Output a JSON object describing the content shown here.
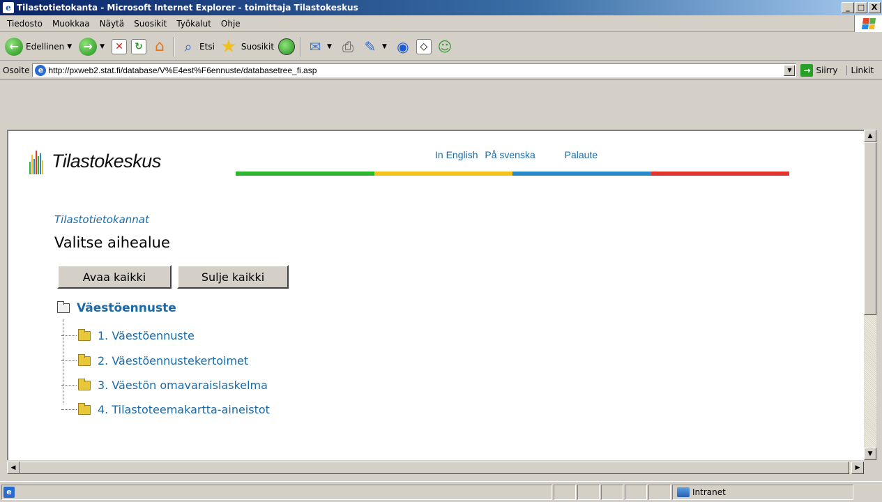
{
  "window": {
    "title": "Tilastotietokanta - Microsoft Internet Explorer - toimittaja Tilastokeskus",
    "buttons": [
      "_",
      "□",
      "X"
    ]
  },
  "menu": {
    "items": [
      "Tiedosto",
      "Muokkaa",
      "Näytä",
      "Suosikit",
      "Työkalut",
      "Ohje"
    ]
  },
  "toolbar": {
    "back_label": "Edellinen",
    "search_label": "Etsi",
    "favorites_label": "Suosikit"
  },
  "address": {
    "label": "Osoite",
    "url": "http://pxweb2.stat.fi/database/V%E4est%F6ennuste/databasetree_fi.asp",
    "go_label": "Siirry",
    "links_label": "Linkit"
  },
  "page": {
    "logo_text": "Tilastokeskus",
    "top_links": [
      "In English",
      "På svenska",
      "Palaute"
    ],
    "bar_colors": [
      "#2db52d",
      "#f5c21b",
      "#2a8ac9",
      "#e0342f"
    ],
    "breadcrumb": "Tilastotietokannat",
    "heading": "Valitse aihealue",
    "open_all": "Avaa kaikki",
    "close_all": "Sulje kaikki",
    "tree": {
      "root": "Väestöennuste",
      "items": [
        "1. Väestöennuste",
        "2. Väestöennustekertoimet",
        "3. Väestön omavaraislaskelma",
        "4. Tilastoteemakartta-aineistot"
      ]
    }
  },
  "status": {
    "zone": "Intranet"
  },
  "colors": {
    "link": "#1a6aa8",
    "titlebar": "#0a246a"
  }
}
